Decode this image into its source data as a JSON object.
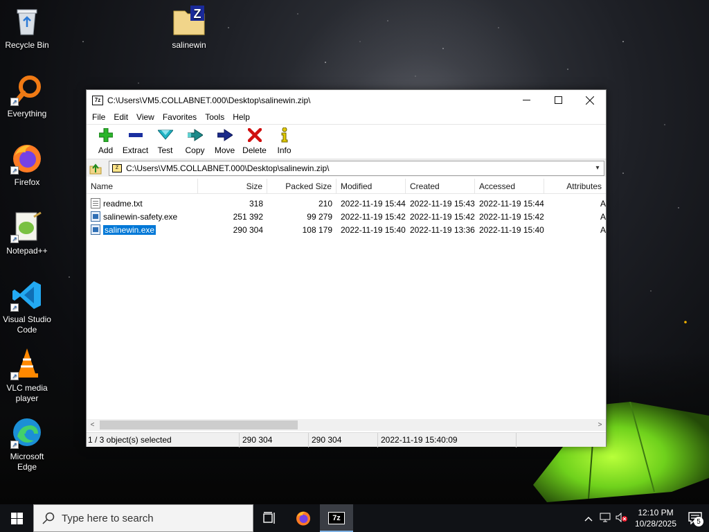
{
  "desktop": {
    "icons": [
      {
        "label": "Recycle Bin",
        "icon": "recycle-bin-icon"
      },
      {
        "label": "Everything",
        "icon": "everything-icon"
      },
      {
        "label": "Firefox",
        "icon": "firefox-icon"
      },
      {
        "label": "Notepad++",
        "icon": "notepadpp-icon"
      },
      {
        "label": "Visual Studio Code",
        "icon": "vscode-icon"
      },
      {
        "label": "VLC media player",
        "icon": "vlc-icon"
      },
      {
        "label": "Microsoft Edge",
        "icon": "edge-icon"
      },
      {
        "label": "salinewin",
        "icon": "zip-folder-icon"
      }
    ]
  },
  "window": {
    "app_icon_text": "7z",
    "title": "C:\\Users\\VM5.COLLABNET.000\\Desktop\\salinewin.zip\\",
    "minimize": "—",
    "maximize": "☐",
    "close": "✕",
    "menu": [
      "File",
      "Edit",
      "View",
      "Favorites",
      "Tools",
      "Help"
    ],
    "toolbar": [
      {
        "label": "Add",
        "icon": "add-icon",
        "color": "#2bb52b"
      },
      {
        "label": "Extract",
        "icon": "extract-icon",
        "color": "#1a2fa0"
      },
      {
        "label": "Test",
        "icon": "test-icon",
        "color": "#1fb3c4"
      },
      {
        "label": "Copy",
        "icon": "copy-icon",
        "color": "#1d8a8a"
      },
      {
        "label": "Move",
        "icon": "move-icon",
        "color": "#1a2a8a"
      },
      {
        "label": "Delete",
        "icon": "delete-icon",
        "color": "#d01010"
      },
      {
        "label": "Info",
        "icon": "info-icon",
        "color": "#d9c200"
      }
    ],
    "address": "C:\\Users\\VM5.COLLABNET.000\\Desktop\\salinewin.zip\\",
    "columns": [
      "Name",
      "Size",
      "Packed Size",
      "Modified",
      "Created",
      "Accessed",
      "Attributes"
    ],
    "files": [
      {
        "name": "readme.txt",
        "type": "txt",
        "size": "318",
        "packed": "210",
        "modified": "2022-11-19 15:44",
        "created": "2022-11-19 15:43",
        "accessed": "2022-11-19 15:44",
        "attr": "A",
        "selected": false
      },
      {
        "name": "salinewin-safety.exe",
        "type": "exe",
        "size": "251 392",
        "packed": "99 279",
        "modified": "2022-11-19 15:42",
        "created": "2022-11-19 15:42",
        "accessed": "2022-11-19 15:42",
        "attr": "A",
        "selected": false
      },
      {
        "name": "salinewin.exe",
        "type": "exe",
        "size": "290 304",
        "packed": "108 179",
        "modified": "2022-11-19 15:40",
        "created": "2022-11-19 13:36",
        "accessed": "2022-11-19 15:40",
        "attr": "A",
        "selected": true
      }
    ],
    "status": {
      "selection": "1 / 3 object(s) selected",
      "size": "290 304",
      "packed": "290 304",
      "modified": "2022-11-19 15:40:09"
    }
  },
  "taskbar": {
    "search_placeholder": "Type here to search",
    "time": "12:10 PM",
    "date": "10/28/2025",
    "notification_count": "5",
    "active_app_text": "7z"
  }
}
